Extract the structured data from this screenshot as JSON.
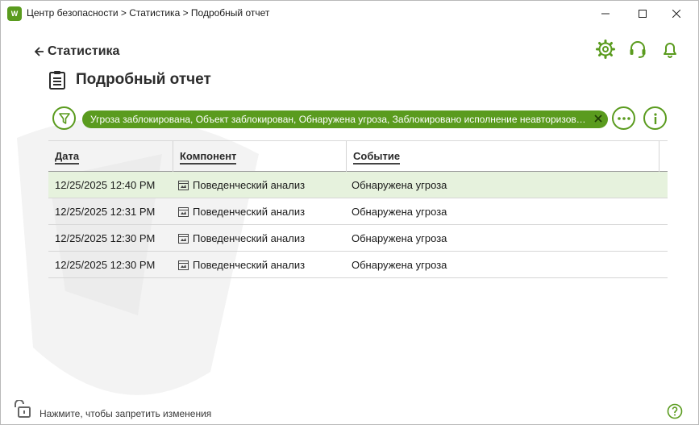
{
  "window": {
    "title": "Центр безопасности > Статистика > Подробный отчет",
    "logo_text": "W"
  },
  "nav": {
    "back_label": "Статистика"
  },
  "page": {
    "title": "Подробный отчет"
  },
  "filter": {
    "chip_text": "Угроза заблокирована, Объект заблокирован, Обнаружена угроза, Заблокировано исполнение неавторизованного кода"
  },
  "table": {
    "columns": [
      "Дата",
      "Компонент",
      "Событие"
    ],
    "rows": [
      {
        "date": "12/25/2025 12:40 PM",
        "component": "Поведенческий анализ",
        "event": "Обнаружена угроза"
      },
      {
        "date": "12/25/2025 12:31 PM",
        "component": "Поведенческий анализ",
        "event": "Обнаружена угроза"
      },
      {
        "date": "12/25/2025 12:30 PM",
        "component": "Поведенческий анализ",
        "event": "Обнаружена угроза"
      },
      {
        "date": "12/25/2025 12:30 PM",
        "component": "Поведенческий анализ",
        "event": "Обнаружена угроза"
      }
    ]
  },
  "footer": {
    "lock_text": "Нажмите, чтобы запретить изменения"
  },
  "colors": {
    "accent": "#5a9b1e",
    "selected_row": "#e6f2dd"
  },
  "icons": {
    "back": "arrow-left-icon",
    "settings": "gear-icon",
    "support": "headset-icon",
    "notifications": "bell-icon",
    "report": "clipboard-icon",
    "filter": "funnel-icon",
    "more": "more-dots-icon",
    "info": "info-icon",
    "component": "component-window-icon",
    "lock": "unlock-icon",
    "help": "help-icon"
  }
}
